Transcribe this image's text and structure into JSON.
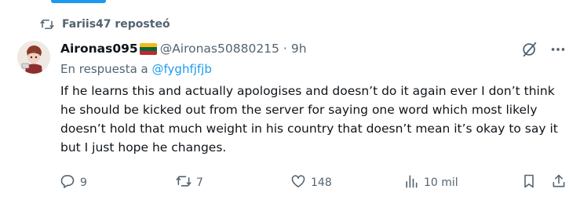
{
  "repost": {
    "label": "Fariis47 reposteó"
  },
  "post": {
    "display_name": "Aironas095",
    "handle": "@Aironas50880215",
    "separator": "·",
    "time": "9h",
    "reply_prefix": "En respuesta a",
    "reply_handle": "@fyghfjfjb",
    "text": "If he learns this and actually apologises and doesn’t do it again ever I don’t think he should be kicked out from the server for saying one word which most likely doesn’t hold that much weight in his country that doesn’t mean it’s okay to say it but I just hope he changes."
  },
  "actions": {
    "replies": "9",
    "reposts": "7",
    "likes": "148",
    "views": "10 mil"
  },
  "colors": {
    "accent": "#1d9bf0",
    "text": "#0f1419",
    "muted": "#536471",
    "flag": [
      "#fdb913",
      "#006a44",
      "#c1272d"
    ]
  }
}
